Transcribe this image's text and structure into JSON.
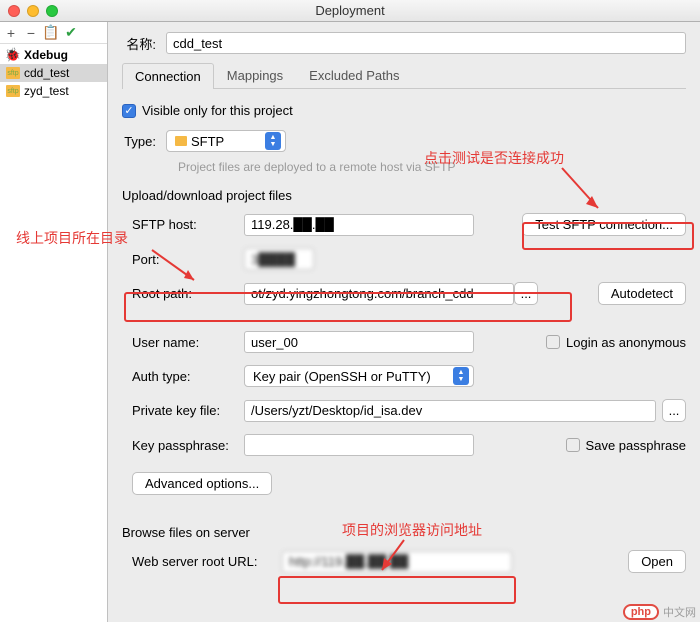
{
  "window": {
    "title": "Deployment"
  },
  "sidebar": {
    "items": [
      {
        "label": "Xdebug"
      },
      {
        "label": "cdd_test"
      },
      {
        "label": "zyd_test"
      }
    ]
  },
  "form": {
    "name_label": "名称:",
    "name_value": "cdd_test",
    "tabs": [
      {
        "label": "Connection",
        "active": true
      },
      {
        "label": "Mappings",
        "active": false
      },
      {
        "label": "Excluded Paths",
        "active": false
      }
    ],
    "visible_label": "Visible only for this project",
    "type_label": "Type:",
    "type_value": "SFTP",
    "deploy_hint": "Project files are deployed to a remote host via SFTP",
    "upload_section": "Upload/download project files",
    "sftp_host_label": "SFTP host:",
    "sftp_host_value": "119.28.██.██",
    "port_label": "Port:",
    "port_value": "3████",
    "root_path_label": "Root path:",
    "root_path_value": "ot/zyd.yingzhongtong.com/branch_cdd",
    "test_conn_label": "Test SFTP connection...",
    "autodetect_label": "Autodetect",
    "user_label": "User name:",
    "user_value": "user_00",
    "anon_label": "Login as anonymous",
    "auth_label": "Auth type:",
    "auth_value": "Key pair (OpenSSH or PuTTY)",
    "key_label": "Private key file:",
    "key_value": "/Users/yzt/Desktop/id_isa.dev",
    "pass_label": "Key passphrase:",
    "save_pass_label": "Save passphrase",
    "advanced_label": "Advanced options...",
    "browse_section": "Browse files on server",
    "web_root_label": "Web server root URL:",
    "web_root_value": "http://119.██.██.██",
    "open_label": "Open"
  },
  "annotations": {
    "a1": "线上项目所在目录",
    "a2": "点击测试是否连接成功",
    "a3": "项目的浏览器访问地址"
  },
  "watermark": {
    "brand": "php",
    "site": "中文网"
  }
}
